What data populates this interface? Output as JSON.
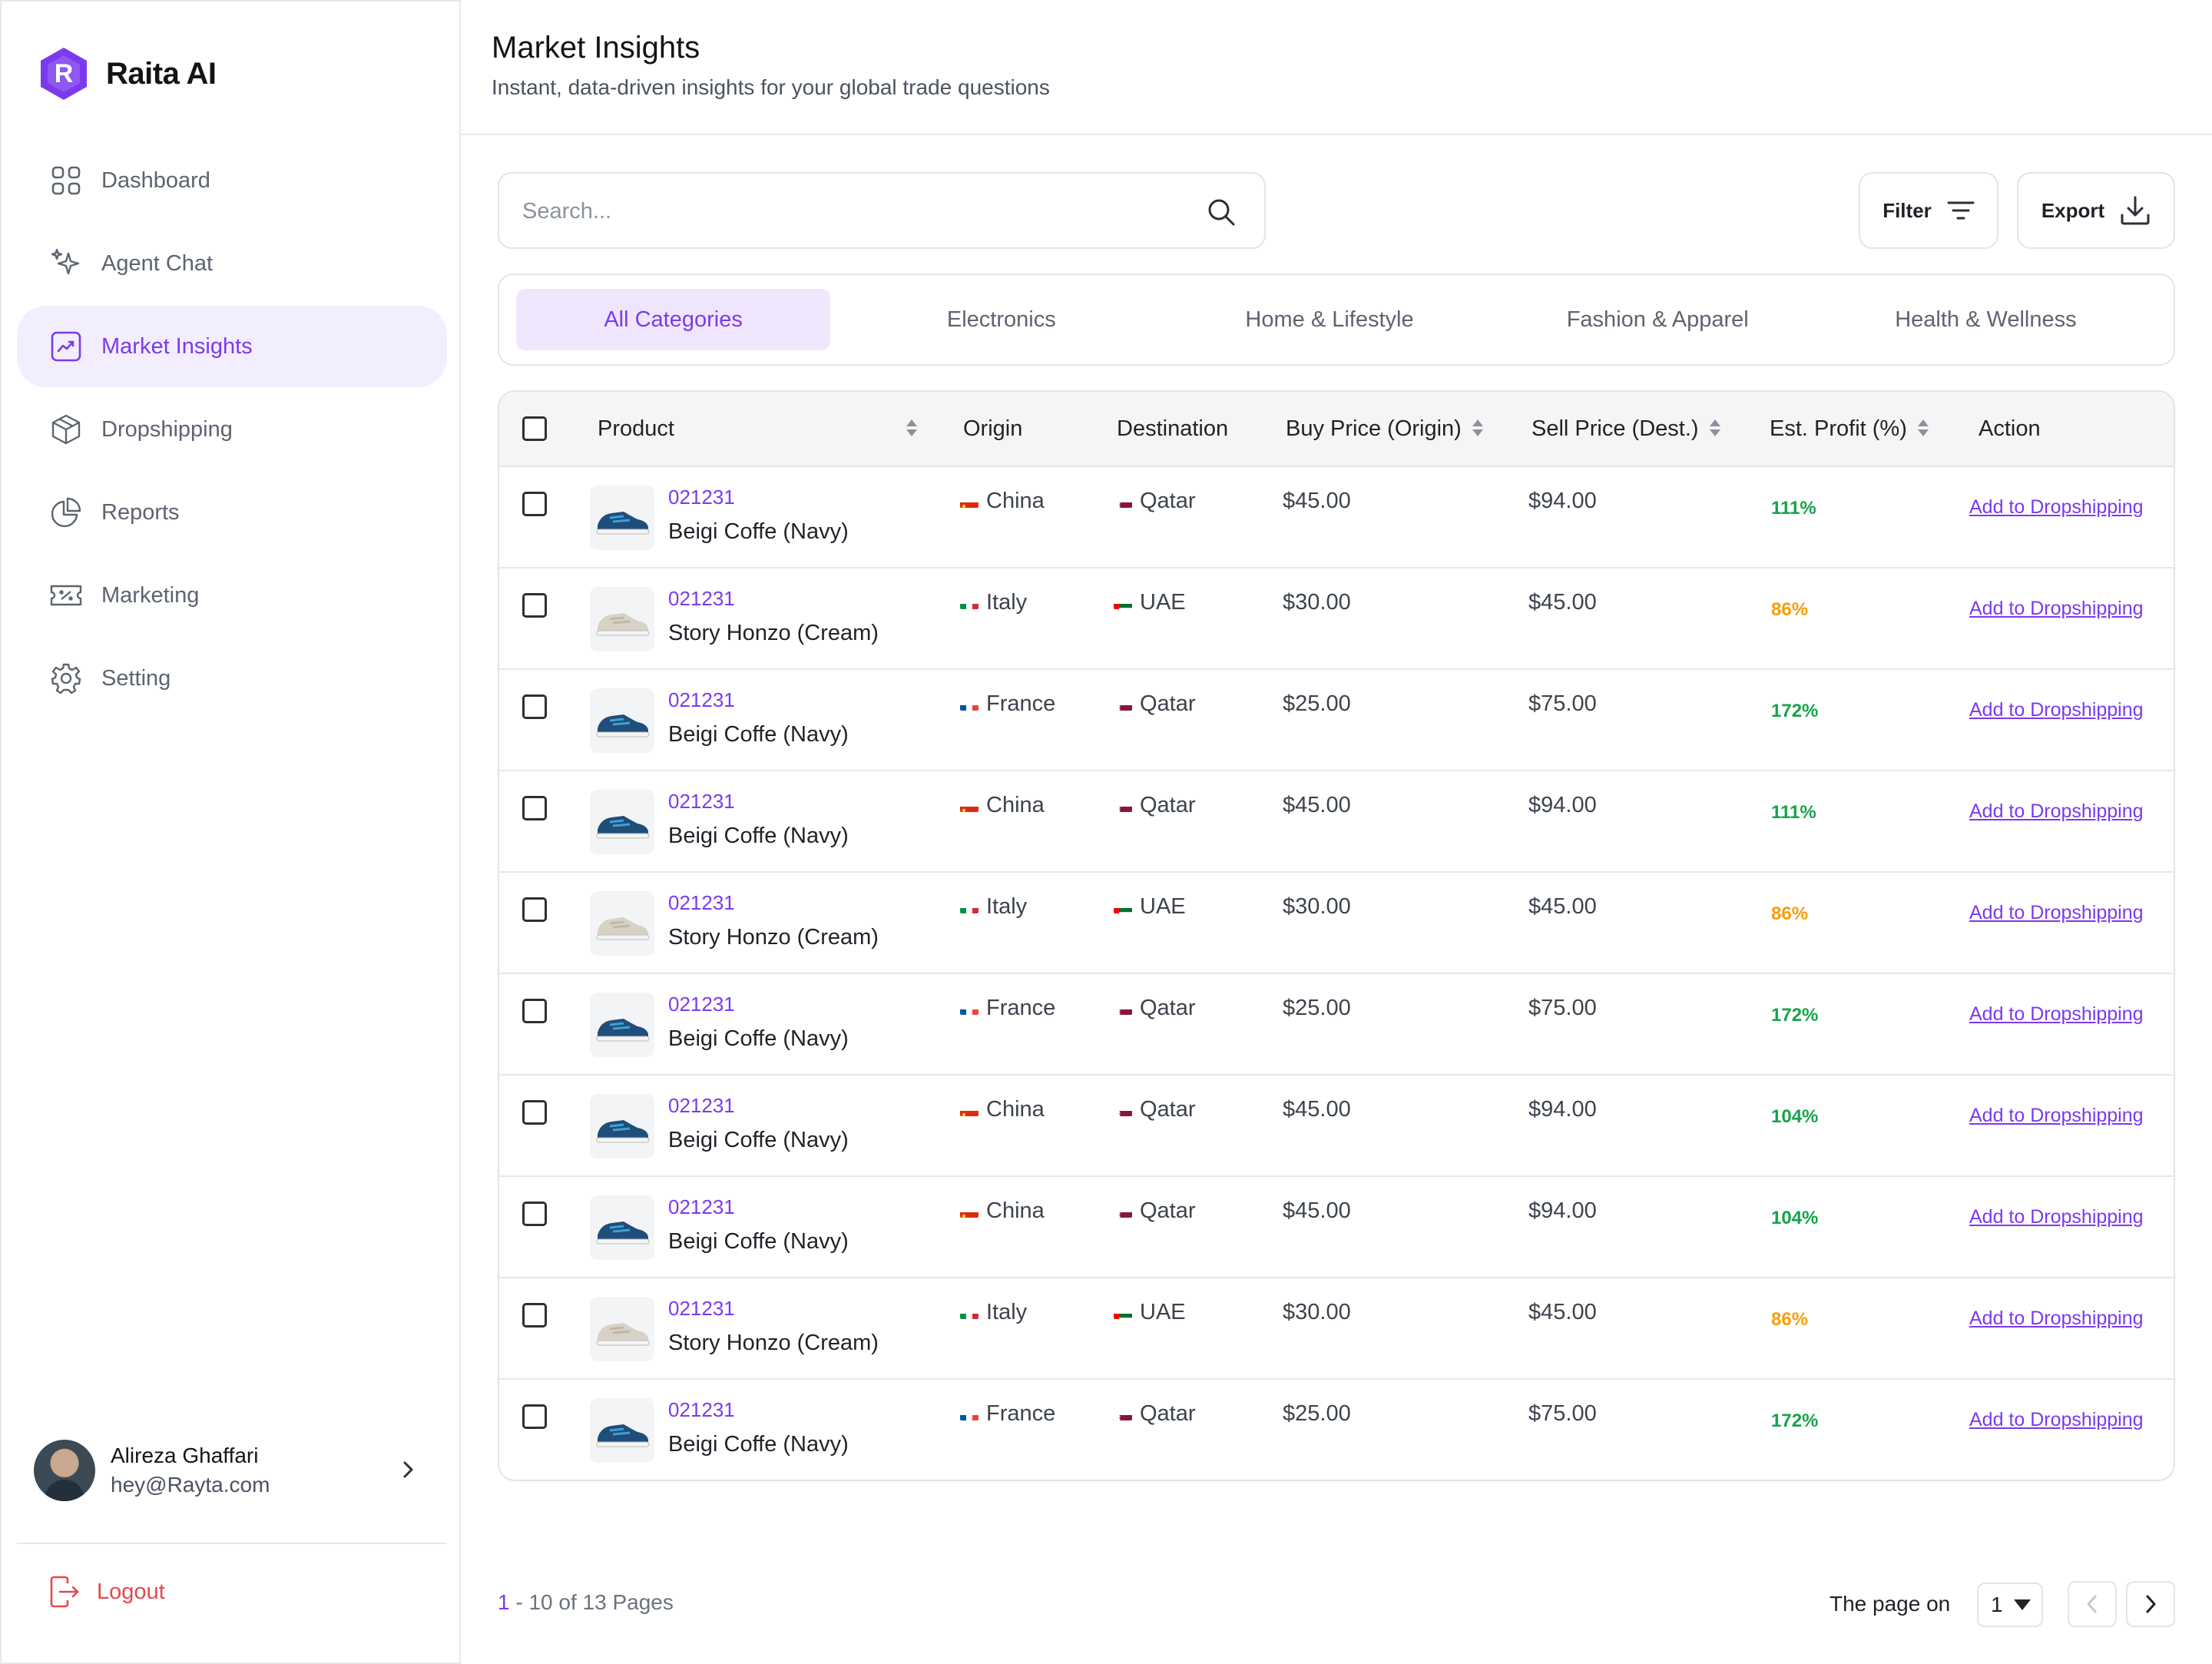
{
  "app": {
    "name": "Raita AI"
  },
  "sidebar": {
    "items": [
      {
        "label": "Dashboard",
        "icon": "grid-icon",
        "active": false
      },
      {
        "label": "Agent Chat",
        "icon": "sparkle-icon",
        "active": false
      },
      {
        "label": "Market Insights",
        "icon": "trend-chart-icon",
        "active": true
      },
      {
        "label": "Dropshipping",
        "icon": "box-icon",
        "active": false
      },
      {
        "label": "Reports",
        "icon": "pie-chart-icon",
        "active": false
      },
      {
        "label": "Marketing",
        "icon": "ticket-icon",
        "active": false
      },
      {
        "label": "Setting",
        "icon": "gear-icon",
        "active": false
      }
    ],
    "profile": {
      "name": "Alireza Ghaffari",
      "email": "hey@Rayta.com"
    },
    "logout_label": "Logout"
  },
  "header": {
    "title": "Market Insights",
    "subtitle": "Instant, data-driven insights for your global trade questions"
  },
  "toolbar": {
    "search_placeholder": "Search...",
    "filter_label": "Filter",
    "export_label": "Export"
  },
  "tabs": [
    {
      "label": "All Categories",
      "active": true
    },
    {
      "label": "Electronics",
      "active": false
    },
    {
      "label": "Home & Lifestyle",
      "active": false
    },
    {
      "label": "Fashion & Apparel",
      "active": false
    },
    {
      "label": "Health & Wellness",
      "active": false
    }
  ],
  "table": {
    "columns": [
      "Product",
      "Origin",
      "Destination",
      "Buy Price (Origin)",
      "Sell Price (Dest.)",
      "Est. Profit (%)",
      "Action"
    ],
    "rows": [
      {
        "id": "021231",
        "name": "Beigi Coffe (Navy)",
        "shoe": "navy",
        "origin": "China",
        "destination": "Qatar",
        "buy": "$45.00",
        "sell": "$94.00",
        "profit": "111%",
        "profit_color": "#15a34a",
        "action": "Add to Dropshipping"
      },
      {
        "id": "021231",
        "name": "Story Honzo (Cream)",
        "shoe": "cream",
        "origin": "Italy",
        "destination": "UAE",
        "buy": "$30.00",
        "sell": "$45.00",
        "profit": "86%",
        "profit_color": "#f59e0b",
        "action": "Add to Dropshipping"
      },
      {
        "id": "021231",
        "name": "Beigi Coffe (Navy)",
        "shoe": "navy",
        "origin": "France",
        "destination": "Qatar",
        "buy": "$25.00",
        "sell": "$75.00",
        "profit": "172%",
        "profit_color": "#15a34a",
        "action": "Add to Dropshipping"
      },
      {
        "id": "021231",
        "name": "Beigi Coffe (Navy)",
        "shoe": "navy",
        "origin": "China",
        "destination": "Qatar",
        "buy": "$45.00",
        "sell": "$94.00",
        "profit": "111%",
        "profit_color": "#15a34a",
        "action": "Add to Dropshipping"
      },
      {
        "id": "021231",
        "name": "Story Honzo (Cream)",
        "shoe": "cream",
        "origin": "Italy",
        "destination": "UAE",
        "buy": "$30.00",
        "sell": "$45.00",
        "profit": "86%",
        "profit_color": "#f59e0b",
        "action": "Add to Dropshipping"
      },
      {
        "id": "021231",
        "name": "Beigi Coffe (Navy)",
        "shoe": "navy",
        "origin": "France",
        "destination": "Qatar",
        "buy": "$25.00",
        "sell": "$75.00",
        "profit": "172%",
        "profit_color": "#15a34a",
        "action": "Add to Dropshipping"
      },
      {
        "id": "021231",
        "name": "Beigi Coffe (Navy)",
        "shoe": "navy",
        "origin": "China",
        "destination": "Qatar",
        "buy": "$45.00",
        "sell": "$94.00",
        "profit": "104%",
        "profit_color": "#15a34a",
        "action": "Add to Dropshipping"
      },
      {
        "id": "021231",
        "name": "Beigi Coffe (Navy)",
        "shoe": "navy",
        "origin": "China",
        "destination": "Qatar",
        "buy": "$45.00",
        "sell": "$94.00",
        "profit": "104%",
        "profit_color": "#15a34a",
        "action": "Add to Dropshipping"
      },
      {
        "id": "021231",
        "name": "Story Honzo (Cream)",
        "shoe": "cream",
        "origin": "Italy",
        "destination": "UAE",
        "buy": "$30.00",
        "sell": "$45.00",
        "profit": "86%",
        "profit_color": "#f59e0b",
        "action": "Add to Dropshipping"
      },
      {
        "id": "021231",
        "name": "Beigi Coffe (Navy)",
        "shoe": "navy",
        "origin": "France",
        "destination": "Qatar",
        "buy": "$25.00",
        "sell": "$75.00",
        "profit": "172%",
        "profit_color": "#15a34a",
        "action": "Add to Dropshipping"
      }
    ]
  },
  "pagination": {
    "current": "1",
    "range_text": " - 10 of 13 Pages",
    "page_on_label": "The page on",
    "selected_page": "1"
  },
  "colors": {
    "accent": "#7c3aed",
    "accent_bg": "#f3eefe",
    "danger": "#e5484d"
  }
}
